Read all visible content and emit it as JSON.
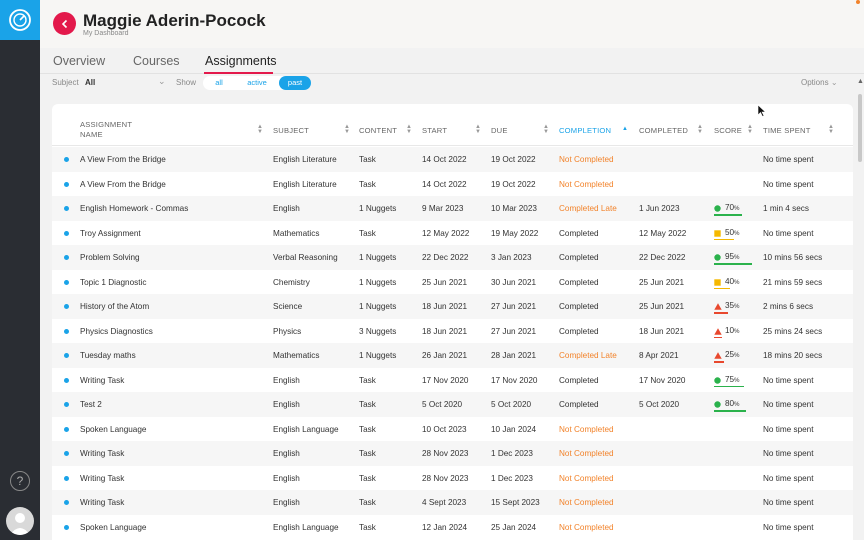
{
  "header": {
    "name": "Maggie Aderin-Pocock",
    "subtitle": "My Dashboard"
  },
  "tabs": [
    {
      "label": "Overview"
    },
    {
      "label": "Courses"
    },
    {
      "label": "Assignments"
    }
  ],
  "filters": {
    "subject_label": "Subject",
    "subject_value": "All",
    "show_label": "Show",
    "show_options": [
      "all",
      "active",
      "past"
    ],
    "show_selected": "past",
    "options_label": "Options"
  },
  "columns": {
    "name": "ASSIGNMENT NAME",
    "subject": "SUBJECT",
    "content": "CONTENT",
    "start": "START",
    "due": "DUE",
    "completion": "COMPLETION",
    "completed": "COMPLETED",
    "score": "SCORE",
    "time_spent": "TIME SPENT"
  },
  "colors": {
    "accent": "#1aa3e8",
    "brand_red": "#e3194b",
    "warning_orange": "#f2832b",
    "score_green": "#2bb24c",
    "score_yellow": "#f5b800",
    "score_red": "#e8482e"
  },
  "rows": [
    {
      "name": "A View From the Bridge",
      "subject": "English Literature",
      "content": "Task",
      "start": "14 Oct 2022",
      "due": "19 Oct 2022",
      "completion": "Not Completed",
      "completed": "",
      "score": "",
      "score_level": "",
      "time_spent": "No time spent"
    },
    {
      "name": "A View From the Bridge",
      "subject": "English Literature",
      "content": "Task",
      "start": "14 Oct 2022",
      "due": "19 Oct 2022",
      "completion": "Not Completed",
      "completed": "",
      "score": "",
      "score_level": "",
      "time_spent": "No time spent"
    },
    {
      "name": "English Homework - Commas",
      "subject": "English",
      "content": "1 Nuggets",
      "start": "9 Mar 2023",
      "due": "10 Mar 2023",
      "completion": "Completed Late",
      "completed": "1 Jun 2023",
      "score": "70",
      "score_level": "green",
      "time_spent": "1 min 4 secs"
    },
    {
      "name": "Troy Assignment",
      "subject": "Mathematics",
      "content": "Task",
      "start": "12 May 2022",
      "due": "19 May 2022",
      "completion": "Completed",
      "completed": "12 May 2022",
      "score": "50",
      "score_level": "yellow",
      "time_spent": "No time spent"
    },
    {
      "name": "Problem Solving",
      "subject": "Verbal Reasoning",
      "content": "1 Nuggets",
      "start": "22 Dec 2022",
      "due": "3 Jan 2023",
      "completion": "Completed",
      "completed": "22 Dec 2022",
      "score": "95",
      "score_level": "green",
      "time_spent": "10 mins 56 secs"
    },
    {
      "name": "Topic 1 Diagnostic",
      "subject": "Chemistry",
      "content": "1 Nuggets",
      "start": "25 Jun 2021",
      "due": "30 Jun 2021",
      "completion": "Completed",
      "completed": "25 Jun 2021",
      "score": "40",
      "score_level": "yellow",
      "time_spent": "21 mins 59 secs"
    },
    {
      "name": "History of the Atom",
      "subject": "Science",
      "content": "1 Nuggets",
      "start": "18 Jun 2021",
      "due": "27 Jun 2021",
      "completion": "Completed",
      "completed": "25 Jun 2021",
      "score": "35",
      "score_level": "red",
      "time_spent": "2 mins 6 secs"
    },
    {
      "name": "Physics Diagnostics",
      "subject": "Physics",
      "content": "3 Nuggets",
      "start": "18 Jun 2021",
      "due": "27 Jun 2021",
      "completion": "Completed",
      "completed": "18 Jun 2021",
      "score": "10",
      "score_level": "red",
      "time_spent": "25 mins 24 secs"
    },
    {
      "name": "Tuesday maths",
      "subject": "Mathematics",
      "content": "1 Nuggets",
      "start": "26 Jan 2021",
      "due": "28 Jan 2021",
      "completion": "Completed Late",
      "completed": "8 Apr 2021",
      "score": "25",
      "score_level": "red",
      "time_spent": "18 mins 20 secs"
    },
    {
      "name": "Writing Task",
      "subject": "English",
      "content": "Task",
      "start": "17 Nov 2020",
      "due": "17 Nov 2020",
      "completion": "Completed",
      "completed": "17 Nov 2020",
      "score": "75",
      "score_level": "green",
      "time_spent": "No time spent"
    },
    {
      "name": "Test 2",
      "subject": "English",
      "content": "Task",
      "start": "5 Oct 2020",
      "due": "5 Oct 2020",
      "completion": "Completed",
      "completed": "5 Oct 2020",
      "score": "80",
      "score_level": "green",
      "time_spent": "No time spent"
    },
    {
      "name": "Spoken Language",
      "subject": "English Language",
      "content": "Task",
      "start": "10 Oct 2023",
      "due": "10 Jan 2024",
      "completion": "Not Completed",
      "completed": "",
      "score": "",
      "score_level": "",
      "time_spent": "No time spent"
    },
    {
      "name": "Writing Task",
      "subject": "English",
      "content": "Task",
      "start": "28 Nov 2023",
      "due": "1 Dec 2023",
      "completion": "Not Completed",
      "completed": "",
      "score": "",
      "score_level": "",
      "time_spent": "No time spent"
    },
    {
      "name": "Writing Task",
      "subject": "English",
      "content": "Task",
      "start": "28 Nov 2023",
      "due": "1 Dec 2023",
      "completion": "Not Completed",
      "completed": "",
      "score": "",
      "score_level": "",
      "time_spent": "No time spent"
    },
    {
      "name": "Writing Task",
      "subject": "English",
      "content": "Task",
      "start": "4 Sept 2023",
      "due": "15 Sept 2023",
      "completion": "Not Completed",
      "completed": "",
      "score": "",
      "score_level": "",
      "time_spent": "No time spent"
    },
    {
      "name": "Spoken Language",
      "subject": "English Language",
      "content": "Task",
      "start": "12 Jan 2024",
      "due": "25 Jan 2024",
      "completion": "Not Completed",
      "completed": "",
      "score": "",
      "score_level": "",
      "time_spent": "No time spent"
    }
  ]
}
